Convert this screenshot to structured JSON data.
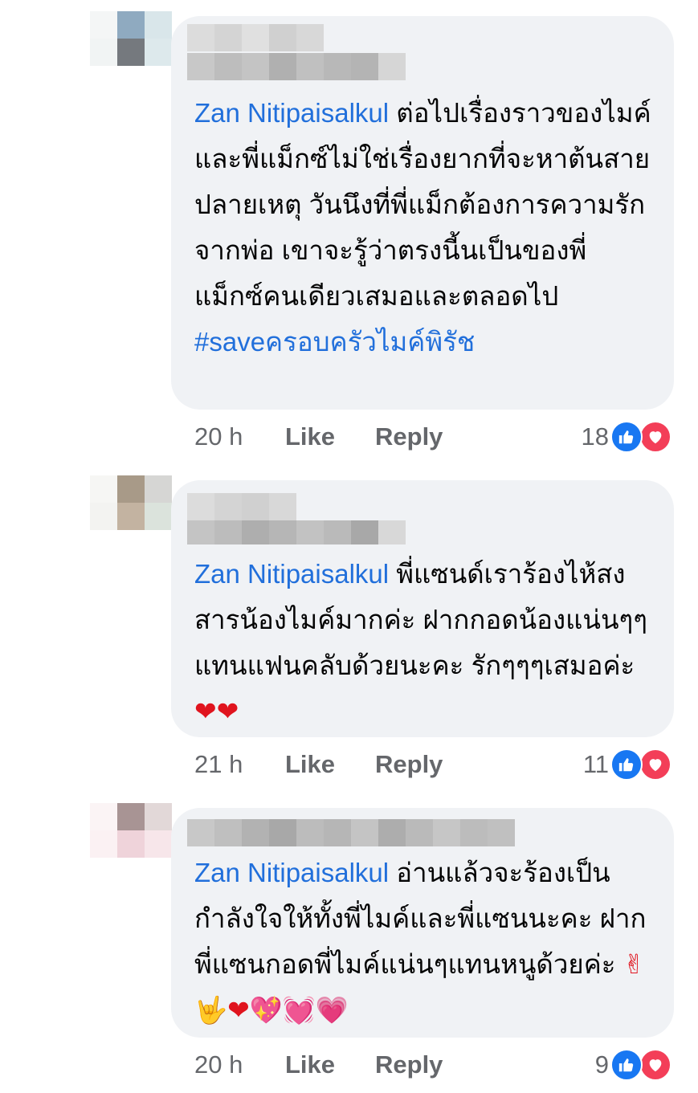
{
  "colors": {
    "bubble_bg": "#f0f2f5",
    "author_link": "#216fdb",
    "meta_text": "#65676b",
    "like_reaction": "#1877f2",
    "love_reaction": "#f33e58"
  },
  "comments": [
    {
      "author": "Zan Nitipaisalkul",
      "text": "  ต่อไปเรื่องราวของไมค์และพี่แม็กซ์ไม่ใช่เรื่องยากที่จะหาต้นสายปลายเหตุ  วันนึงที่พี่แม็กต้องการความรักจากพ่อ เขาจะรู้ว่าตรงนี้นเป็นของพี่แม็กซ์คนเดียวเสมอและตลอดไป ",
      "hashtag": "#saveครอบครัวไมค์พิรัช",
      "time": "20 h",
      "like_label": "Like",
      "reply_label": "Reply",
      "reaction_count": "18",
      "reaction_icons": [
        "like-reaction-icon",
        "love-reaction-icon"
      ]
    },
    {
      "author": "Zan Nitipaisalkul",
      "text": " พี่แซนด์เราร้องไห้สงสารน้องไมค์มากค่ะ ฝากกอดน้องแน่นๆๆแทนแฟนคลับด้วยนะคะ รักๆๆๆเสมอค่ะ ",
      "emoji": "❤❤",
      "time": "21 h",
      "like_label": "Like",
      "reply_label": "Reply",
      "reaction_count": "11",
      "reaction_icons": [
        "like-reaction-icon",
        "love-reaction-icon"
      ]
    },
    {
      "author": "Zan Nitipaisalkul",
      "text": " อ่านแล้วจะร้องเป็นกำลังใจให้ทั้งพี่ไมค์และพี่แซนนะคะ ฝากพี่แซนกอดพี่ไมค์แน่นๆแทนหนูด้วยค่ะ ",
      "emoji": "✌🤟❤💖💓💗",
      "time": "20 h",
      "like_label": "Like",
      "reply_label": "Reply",
      "reaction_count": "9",
      "reaction_icons": [
        "like-reaction-icon",
        "love-reaction-icon"
      ]
    }
  ]
}
